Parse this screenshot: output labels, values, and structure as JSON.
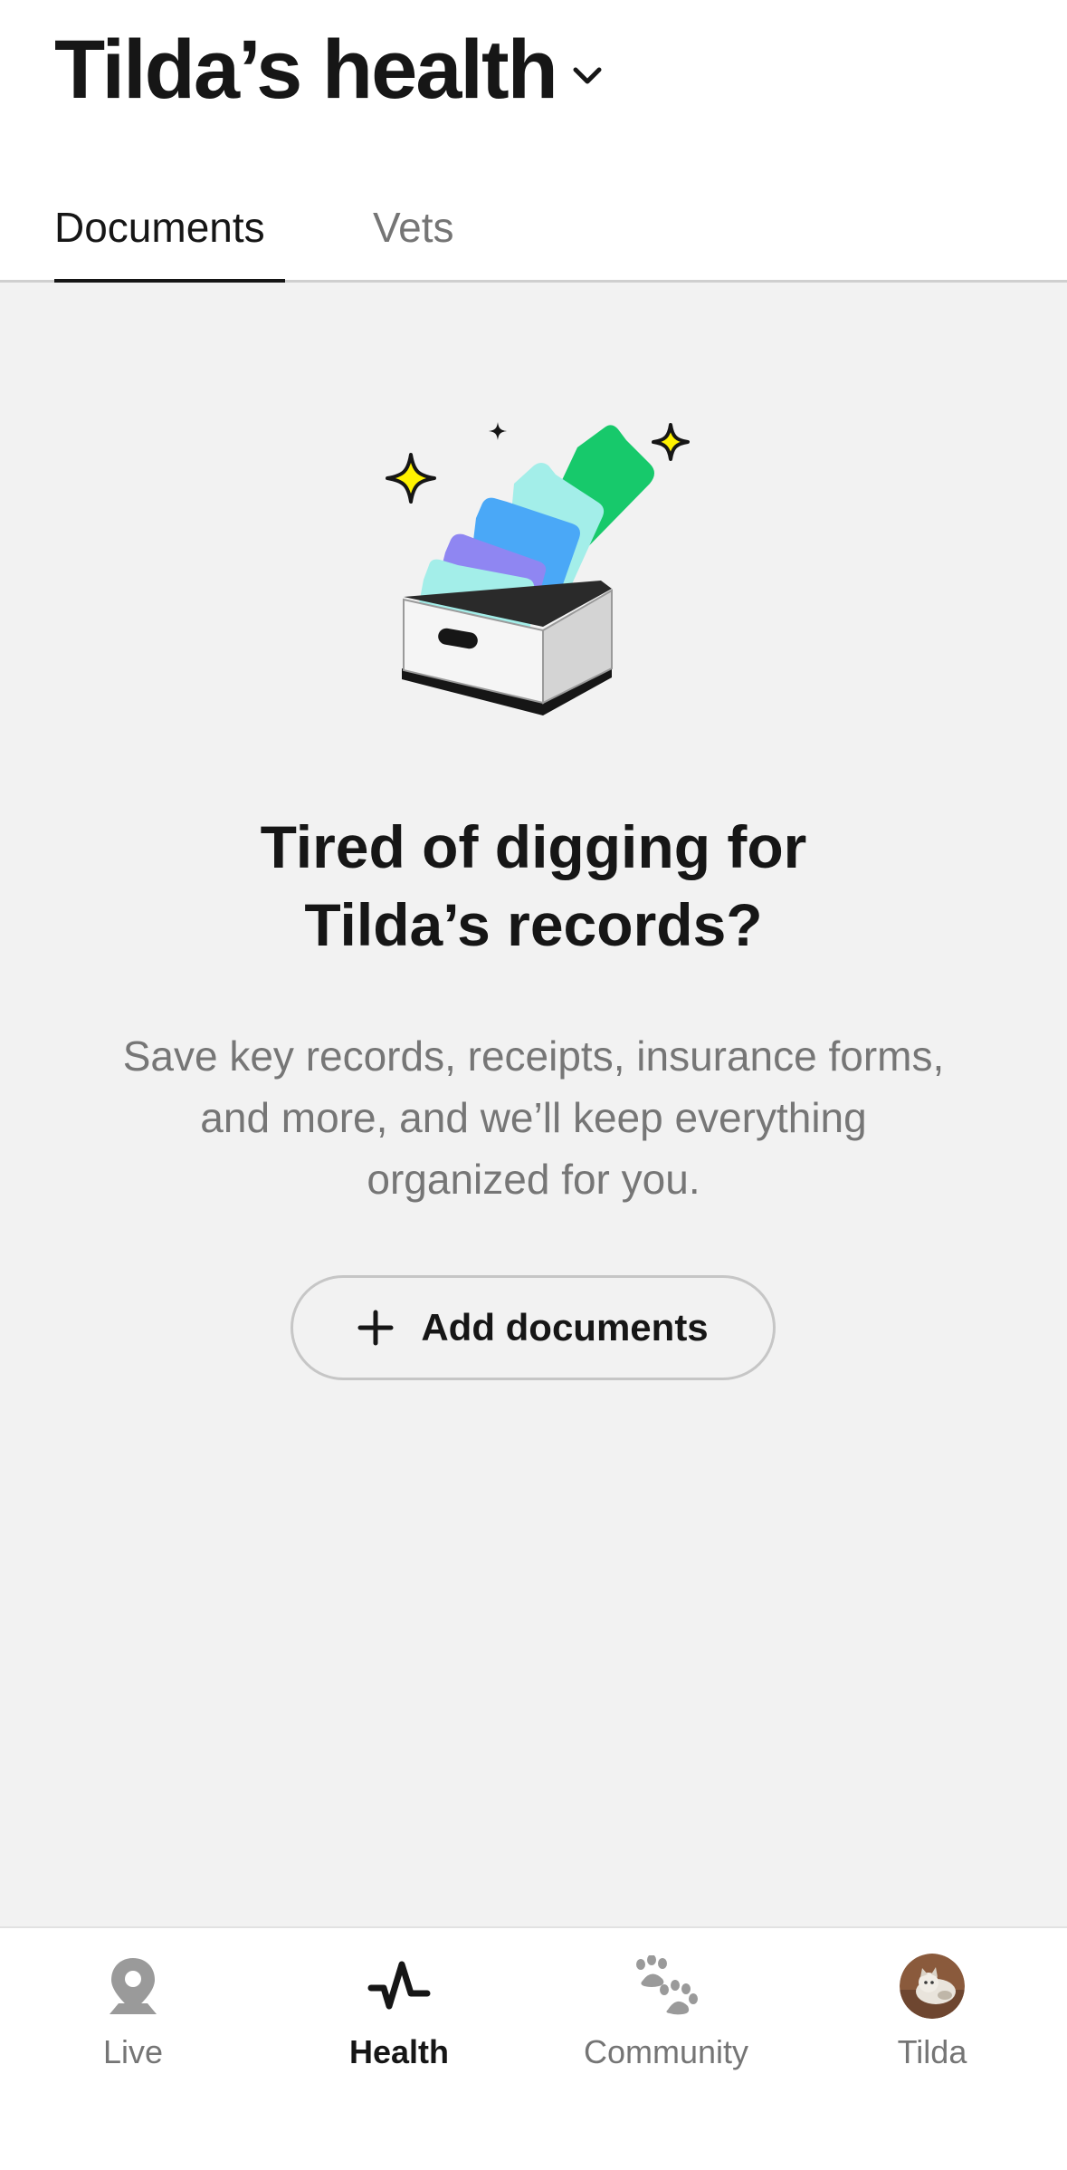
{
  "header": {
    "title": "Tilda’s health",
    "tabs": [
      {
        "label": "Documents",
        "active": true
      },
      {
        "label": "Vets",
        "active": false
      }
    ]
  },
  "empty_state": {
    "illustration": "file-box-illustration",
    "headline_line1": "Tired of digging for",
    "headline_line2": "Tilda’s records?",
    "description_line1": "Save key records, receipts, insurance forms,",
    "description_line2": "and more, and we’ll keep everything",
    "description_line3": "organized for you.",
    "add_button_label": "Add documents",
    "add_button_icon": "plus-icon"
  },
  "bottom_nav": {
    "items": [
      {
        "label": "Live",
        "icon": "location-pin-icon",
        "active": false
      },
      {
        "label": "Health",
        "icon": "pulse-icon",
        "active": true
      },
      {
        "label": "Community",
        "icon": "paw-icon",
        "active": false
      },
      {
        "label": "Tilda",
        "icon": "pet-avatar",
        "active": false
      }
    ]
  },
  "colors": {
    "text_primary": "#161616",
    "text_secondary": "#757575",
    "background": "#f2f2f2",
    "folder_green": "#17c96b",
    "folder_mint": "#a3eee9",
    "folder_blue": "#4aa8f7",
    "folder_purple": "#8f86f2",
    "sparkle_yellow": "#fff200"
  }
}
